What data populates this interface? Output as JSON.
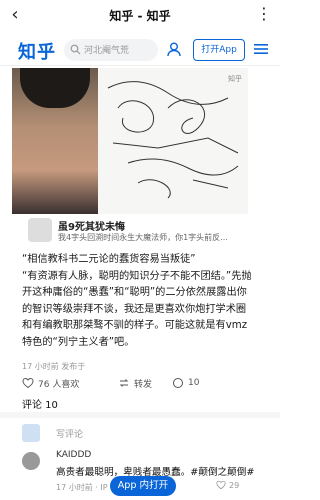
{
  "topbar": {
    "title": "知乎 - 知乎"
  },
  "header": {
    "logo": "知乎",
    "search_placeholder": "河北阉气荒",
    "open_app": "打开App"
  },
  "video": {
    "watermark": "知乎"
  },
  "poster": {
    "name": "虽9死其犹未悔",
    "bio": "我4字头回溯时间永生大魔法师，你1字头前反..."
  },
  "content": {
    "paragraphs": [
      "“相信教科书二元论的蠢货容易当叛徒”",
      "“有资源有人脉，聪明的知识分子不能不团结。”先抛开这种庸俗的“愚蠢”和“聪明”的二分依然展露出你的智识等级崇拜不谈，我还是更喜欢你炮打学术圈和有编教职那桀骜不驯的样子。可能这就是有vmz特色的“列宁主义者”吧。"
    ]
  },
  "time": "17 小时前 发布于",
  "actions": {
    "likes": "76 人喜欢",
    "repost": "转发",
    "comments": "10"
  },
  "comment_count": "评论 10",
  "write": {
    "placeholder": "写评论"
  },
  "comment": {
    "name": "KAIDDD",
    "text": "高贵者最聪明，卑贱者最愚蠢。#颠倒之颠倒#",
    "meta": "17 小时前 · IP",
    "likes": "29"
  },
  "bottom": {
    "open_app": "App 内打开"
  },
  "colors": {
    "brand": "#0a66d8"
  }
}
